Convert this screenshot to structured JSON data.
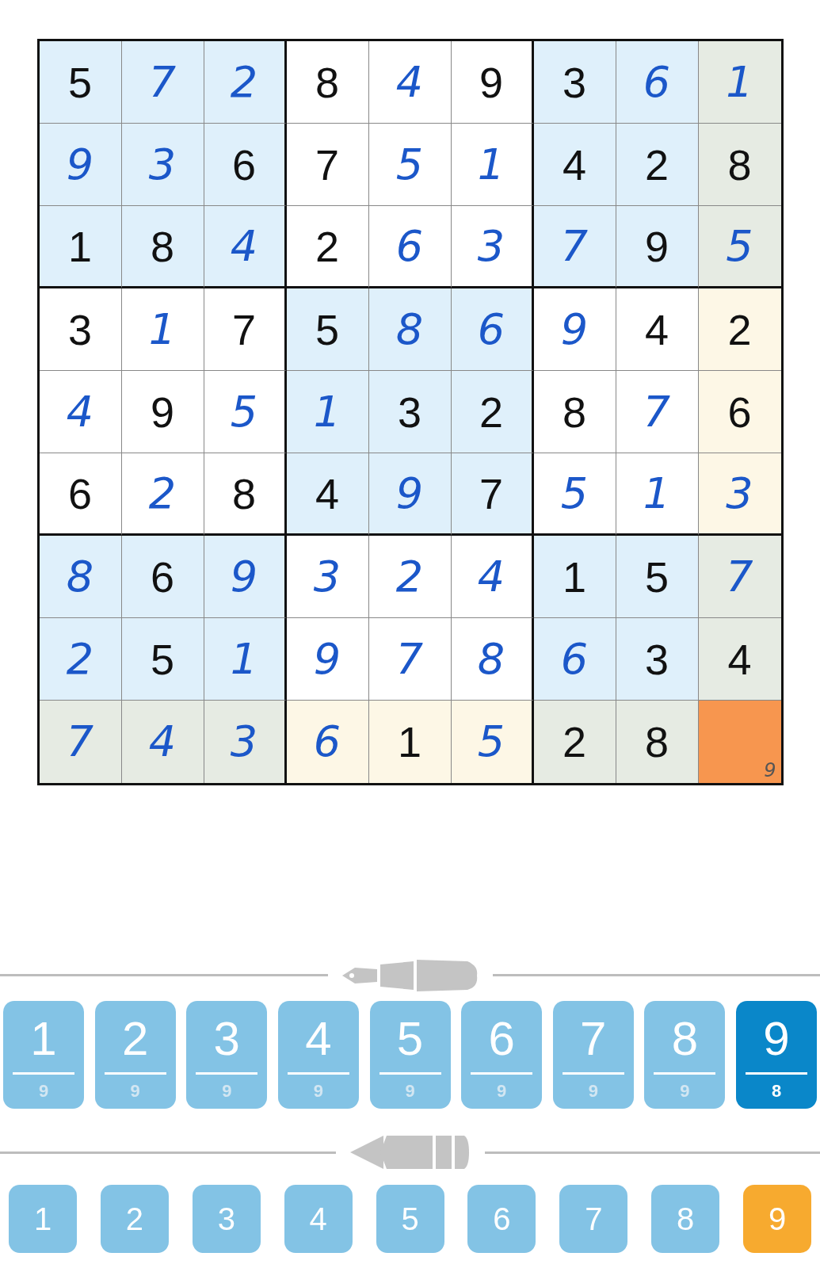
{
  "grid": {
    "rows": [
      {
        "cells": [
          {
            "value": "5",
            "kind": "given",
            "highlighted": false,
            "selected": false
          },
          {
            "value": "7",
            "kind": "entered",
            "highlighted": false,
            "selected": false
          },
          {
            "value": "2",
            "kind": "entered",
            "highlighted": false,
            "selected": false
          },
          {
            "value": "8",
            "kind": "given",
            "highlighted": false,
            "selected": false
          },
          {
            "value": "4",
            "kind": "entered",
            "highlighted": false,
            "selected": false
          },
          {
            "value": "9",
            "kind": "given",
            "highlighted": false,
            "selected": false
          },
          {
            "value": "3",
            "kind": "given",
            "highlighted": false,
            "selected": false
          },
          {
            "value": "6",
            "kind": "entered",
            "highlighted": false,
            "selected": false
          },
          {
            "value": "1",
            "kind": "entered",
            "highlighted": true,
            "selected": false
          }
        ]
      },
      {
        "cells": [
          {
            "value": "9",
            "kind": "entered",
            "highlighted": false,
            "selected": false
          },
          {
            "value": "3",
            "kind": "entered",
            "highlighted": false,
            "selected": false
          },
          {
            "value": "6",
            "kind": "given",
            "highlighted": false,
            "selected": false
          },
          {
            "value": "7",
            "kind": "given",
            "highlighted": false,
            "selected": false
          },
          {
            "value": "5",
            "kind": "entered",
            "highlighted": false,
            "selected": false
          },
          {
            "value": "1",
            "kind": "entered",
            "highlighted": false,
            "selected": false
          },
          {
            "value": "4",
            "kind": "given",
            "highlighted": false,
            "selected": false
          },
          {
            "value": "2",
            "kind": "given",
            "highlighted": false,
            "selected": false
          },
          {
            "value": "8",
            "kind": "given",
            "highlighted": true,
            "selected": false
          }
        ]
      },
      {
        "cells": [
          {
            "value": "1",
            "kind": "given",
            "highlighted": false,
            "selected": false
          },
          {
            "value": "8",
            "kind": "given",
            "highlighted": false,
            "selected": false
          },
          {
            "value": "4",
            "kind": "entered",
            "highlighted": false,
            "selected": false
          },
          {
            "value": "2",
            "kind": "given",
            "highlighted": false,
            "selected": false
          },
          {
            "value": "6",
            "kind": "entered",
            "highlighted": false,
            "selected": false
          },
          {
            "value": "3",
            "kind": "entered",
            "highlighted": false,
            "selected": false
          },
          {
            "value": "7",
            "kind": "entered",
            "highlighted": false,
            "selected": false
          },
          {
            "value": "9",
            "kind": "given",
            "highlighted": false,
            "selected": false
          },
          {
            "value": "5",
            "kind": "entered",
            "highlighted": true,
            "selected": false
          }
        ]
      },
      {
        "cells": [
          {
            "value": "3",
            "kind": "given",
            "highlighted": false,
            "selected": false
          },
          {
            "value": "1",
            "kind": "entered",
            "highlighted": false,
            "selected": false
          },
          {
            "value": "7",
            "kind": "given",
            "highlighted": false,
            "selected": false
          },
          {
            "value": "5",
            "kind": "given",
            "highlighted": false,
            "selected": false
          },
          {
            "value": "8",
            "kind": "entered",
            "highlighted": false,
            "selected": false
          },
          {
            "value": "6",
            "kind": "entered",
            "highlighted": false,
            "selected": false
          },
          {
            "value": "9",
            "kind": "entered",
            "highlighted": false,
            "selected": false
          },
          {
            "value": "4",
            "kind": "given",
            "highlighted": false,
            "selected": false
          },
          {
            "value": "2",
            "kind": "given",
            "highlighted": true,
            "selected": false
          }
        ]
      },
      {
        "cells": [
          {
            "value": "4",
            "kind": "entered",
            "highlighted": false,
            "selected": false
          },
          {
            "value": "9",
            "kind": "given",
            "highlighted": false,
            "selected": false
          },
          {
            "value": "5",
            "kind": "entered",
            "highlighted": false,
            "selected": false
          },
          {
            "value": "1",
            "kind": "entered",
            "highlighted": false,
            "selected": false
          },
          {
            "value": "3",
            "kind": "given",
            "highlighted": false,
            "selected": false
          },
          {
            "value": "2",
            "kind": "given",
            "highlighted": false,
            "selected": false
          },
          {
            "value": "8",
            "kind": "given",
            "highlighted": false,
            "selected": false
          },
          {
            "value": "7",
            "kind": "entered",
            "highlighted": false,
            "selected": false
          },
          {
            "value": "6",
            "kind": "given",
            "highlighted": true,
            "selected": false
          }
        ]
      },
      {
        "cells": [
          {
            "value": "6",
            "kind": "given",
            "highlighted": false,
            "selected": false
          },
          {
            "value": "2",
            "kind": "entered",
            "highlighted": false,
            "selected": false
          },
          {
            "value": "8",
            "kind": "given",
            "highlighted": false,
            "selected": false
          },
          {
            "value": "4",
            "kind": "given",
            "highlighted": false,
            "selected": false
          },
          {
            "value": "9",
            "kind": "entered",
            "highlighted": false,
            "selected": false
          },
          {
            "value": "7",
            "kind": "given",
            "highlighted": false,
            "selected": false
          },
          {
            "value": "5",
            "kind": "entered",
            "highlighted": false,
            "selected": false
          },
          {
            "value": "1",
            "kind": "entered",
            "highlighted": false,
            "selected": false
          },
          {
            "value": "3",
            "kind": "entered",
            "highlighted": true,
            "selected": false
          }
        ]
      },
      {
        "cells": [
          {
            "value": "8",
            "kind": "entered",
            "highlighted": false,
            "selected": false
          },
          {
            "value": "6",
            "kind": "given",
            "highlighted": false,
            "selected": false
          },
          {
            "value": "9",
            "kind": "entered",
            "highlighted": false,
            "selected": false
          },
          {
            "value": "3",
            "kind": "entered",
            "highlighted": false,
            "selected": false
          },
          {
            "value": "2",
            "kind": "entered",
            "highlighted": false,
            "selected": false
          },
          {
            "value": "4",
            "kind": "entered",
            "highlighted": false,
            "selected": false
          },
          {
            "value": "1",
            "kind": "given",
            "highlighted": false,
            "selected": false
          },
          {
            "value": "5",
            "kind": "given",
            "highlighted": false,
            "selected": false
          },
          {
            "value": "7",
            "kind": "entered",
            "highlighted": true,
            "selected": false
          }
        ]
      },
      {
        "cells": [
          {
            "value": "2",
            "kind": "entered",
            "highlighted": false,
            "selected": false
          },
          {
            "value": "5",
            "kind": "given",
            "highlighted": false,
            "selected": false
          },
          {
            "value": "1",
            "kind": "entered",
            "highlighted": false,
            "selected": false
          },
          {
            "value": "9",
            "kind": "entered",
            "highlighted": false,
            "selected": false
          },
          {
            "value": "7",
            "kind": "entered",
            "highlighted": false,
            "selected": false
          },
          {
            "value": "8",
            "kind": "entered",
            "highlighted": false,
            "selected": false
          },
          {
            "value": "6",
            "kind": "entered",
            "highlighted": false,
            "selected": false
          },
          {
            "value": "3",
            "kind": "given",
            "highlighted": false,
            "selected": false
          },
          {
            "value": "4",
            "kind": "given",
            "highlighted": true,
            "selected": false
          }
        ]
      },
      {
        "cells": [
          {
            "value": "7",
            "kind": "entered",
            "highlighted": true,
            "selected": false
          },
          {
            "value": "4",
            "kind": "entered",
            "highlighted": true,
            "selected": false
          },
          {
            "value": "3",
            "kind": "entered",
            "highlighted": true,
            "selected": false
          },
          {
            "value": "6",
            "kind": "entered",
            "highlighted": true,
            "selected": false
          },
          {
            "value": "1",
            "kind": "given",
            "highlighted": true,
            "selected": false
          },
          {
            "value": "5",
            "kind": "entered",
            "highlighted": true,
            "selected": false
          },
          {
            "value": "2",
            "kind": "given",
            "highlighted": true,
            "selected": false
          },
          {
            "value": "8",
            "kind": "given",
            "highlighted": true,
            "selected": false
          },
          {
            "value": "9",
            "kind": "note",
            "selected": true
          }
        ]
      }
    ]
  },
  "pen_keys": [
    {
      "digit": "1",
      "count": "9",
      "selected": false
    },
    {
      "digit": "2",
      "count": "9",
      "selected": false
    },
    {
      "digit": "3",
      "count": "9",
      "selected": false
    },
    {
      "digit": "4",
      "count": "9",
      "selected": false
    },
    {
      "digit": "5",
      "count": "9",
      "selected": false
    },
    {
      "digit": "6",
      "count": "9",
      "selected": false
    },
    {
      "digit": "7",
      "count": "9",
      "selected": false
    },
    {
      "digit": "8",
      "count": "9",
      "selected": false
    },
    {
      "digit": "9",
      "count": "8",
      "selected": true
    }
  ],
  "pencil_keys": [
    {
      "digit": "1",
      "selected": false
    },
    {
      "digit": "2",
      "selected": false
    },
    {
      "digit": "3",
      "selected": false
    },
    {
      "digit": "4",
      "selected": false
    },
    {
      "digit": "5",
      "selected": false
    },
    {
      "digit": "6",
      "selected": false
    },
    {
      "digit": "7",
      "selected": false
    },
    {
      "digit": "8",
      "selected": false
    },
    {
      "digit": "9",
      "selected": true
    }
  ]
}
